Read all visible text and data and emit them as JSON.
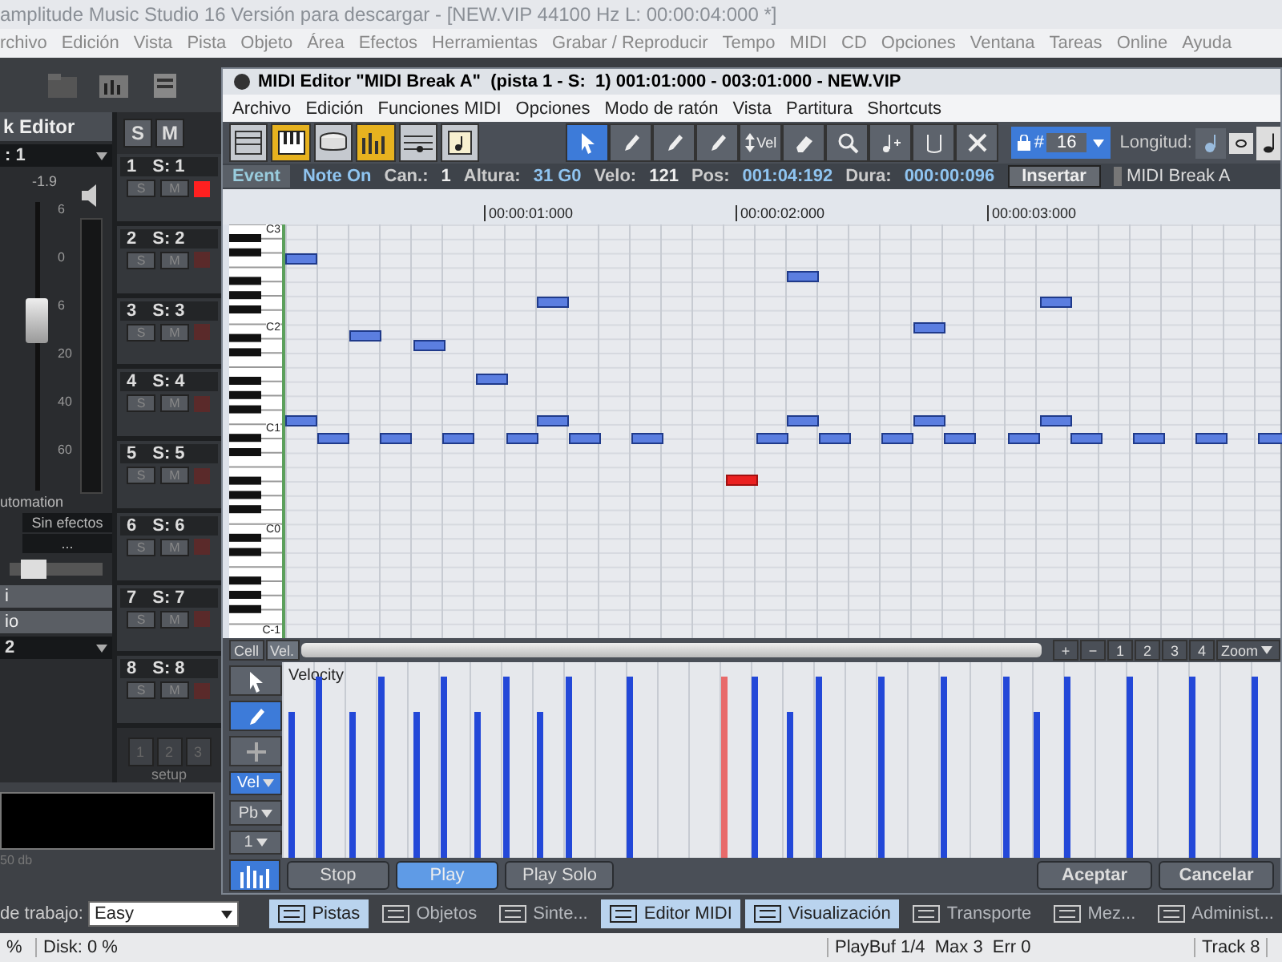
{
  "main_window": {
    "title": "amplitude Music Studio 16 Versión para descargar - [NEW.VIP   44100 Hz L: 00:00:04:000 *]",
    "menu": [
      "rchivo",
      "Edición",
      "Vista",
      "Pista",
      "Objeto",
      "Área",
      "Efectos",
      "Herramientas",
      "Grabar / Reproducir",
      "Tempo",
      "MIDI",
      "CD",
      "Opciones",
      "Ventana",
      "Tareas",
      "Online",
      "Ayuda"
    ]
  },
  "left_panel": {
    "solo_label": "S",
    "mute_label": "M",
    "editor_title": "k Editor",
    "track_select": ": 1",
    "fader_reading": "-1.9",
    "scale": [
      "6",
      "0",
      "6",
      "20",
      "40",
      "60"
    ],
    "automation_label": "utomation",
    "effects_button": "Sin efectos",
    "effects_more": "...",
    "pan": {
      "level": 0.25
    },
    "section_1": "i",
    "section_2": "io",
    "dropdown_1": "2",
    "tracks": [
      {
        "number": "1",
        "name": "S: 1",
        "solo": "S",
        "mute": "M",
        "armed": true
      },
      {
        "number": "2",
        "name": "S: 2",
        "solo": "S",
        "mute": "M",
        "armed": false
      },
      {
        "number": "3",
        "name": "S: 3",
        "solo": "S",
        "mute": "M",
        "armed": false
      },
      {
        "number": "4",
        "name": "S: 4",
        "solo": "S",
        "mute": "M",
        "armed": false
      },
      {
        "number": "5",
        "name": "S: 5",
        "solo": "S",
        "mute": "M",
        "armed": false
      },
      {
        "number": "6",
        "name": "S: 6",
        "solo": "S",
        "mute": "M",
        "armed": false
      },
      {
        "number": "7",
        "name": "S: 7",
        "solo": "S",
        "mute": "M",
        "armed": false
      },
      {
        "number": "8",
        "name": "S: 8",
        "solo": "S",
        "mute": "M",
        "armed": false
      }
    ],
    "setup_buttons": [
      "1",
      "2",
      "3"
    ],
    "setup_label": "setup",
    "meter_label": "50 db",
    "workspace_label": "de trabajo:",
    "workspace_value": "Easy"
  },
  "midi_editor": {
    "title": "MIDI Editor \"MIDI Break A\"  (pista 1 - S:  1) 001:01:000 - 003:01:000 - NEW.VIP",
    "menu": [
      "Archivo",
      "Edición",
      "Funciones MIDI",
      "Opciones",
      "Modo de ratón",
      "Vista",
      "Partitura",
      "Shortcuts"
    ],
    "view_buttons": [
      {
        "kind": "list",
        "selected": false
      },
      {
        "kind": "piano",
        "selected": true
      },
      {
        "kind": "drum",
        "selected": false
      },
      {
        "kind": "bars",
        "selected": true
      },
      {
        "kind": "score",
        "selected": false
      },
      {
        "kind": "sheet",
        "selected": false
      }
    ],
    "tools": [
      {
        "kind": "pointer",
        "selected": true
      },
      {
        "kind": "pencil",
        "selected": false
      },
      {
        "kind": "line",
        "selected": false
      },
      {
        "kind": "multi",
        "selected": false
      },
      {
        "kind": "vel",
        "label": "Vel",
        "selected": false
      },
      {
        "kind": "eraser",
        "selected": false
      },
      {
        "kind": "zoom",
        "selected": false
      },
      {
        "kind": "noteplus",
        "selected": false
      },
      {
        "kind": "tie",
        "selected": false
      },
      {
        "kind": "cross",
        "selected": false
      }
    ],
    "quantize": {
      "lock_label": "#",
      "value": "16"
    },
    "length_label": "Longitud:",
    "event_bar": {
      "tab": "Event",
      "type": "Note On",
      "channel_label": "Can.:",
      "channel": "1",
      "pitch_label": "Altura:",
      "pitch": "31 G0",
      "velocity_label": "Velo:",
      "velocity": "121",
      "position_label": "Pos:",
      "position": "001:04:192",
      "duration_label": "Dura:",
      "duration": "000:00:096",
      "insert_button": "Insertar",
      "object_name": "MIDI Break A"
    },
    "ruler": [
      "00:00:01:000",
      "00:00:02:000",
      "00:00:03:000"
    ],
    "keyboard_labels": [
      "C3",
      "C2",
      "C1",
      "C0",
      "C-1"
    ],
    "cell_tab": "Cell",
    "vel_tab": "Vel.",
    "scroll_buttons": [
      "+",
      "−",
      "1",
      "2",
      "3",
      "4"
    ],
    "zoom_label": "Zoom",
    "velocity_label": "Velocity",
    "side_tools": [
      {
        "kind": "pointer",
        "selected": false
      },
      {
        "kind": "pencil",
        "selected": true
      },
      {
        "kind": "plus",
        "selected": false
      }
    ],
    "side_selects": [
      {
        "label": "Vel",
        "selected": true
      },
      {
        "label": "Pb",
        "selected": false
      },
      {
        "label": "1",
        "selected": false
      }
    ],
    "transport": [
      {
        "label": "Stop",
        "selected": false
      },
      {
        "label": "Play",
        "selected": true
      },
      {
        "label": "Play Solo",
        "selected": false
      }
    ],
    "dialog_buttons": [
      "Aceptar",
      "Cancelar"
    ]
  },
  "taskbar": [
    {
      "label": "Pistas",
      "selected": true
    },
    {
      "label": "Objetos",
      "selected": false
    },
    {
      "label": "Sinte...",
      "selected": false
    },
    {
      "label": "Editor MIDI",
      "selected": true
    },
    {
      "label": "Visualización",
      "selected": true
    },
    {
      "label": "Transporte",
      "selected": false
    },
    {
      "label": "Mez...",
      "selected": false
    },
    {
      "label": "Administ...",
      "selected": false
    }
  ],
  "status_bar": {
    "cpu": "%",
    "disk": "Disk: 0 %",
    "playbuf": "PlayBuf 1/4  Max 3  Err 0",
    "track": "Track 8"
  }
}
